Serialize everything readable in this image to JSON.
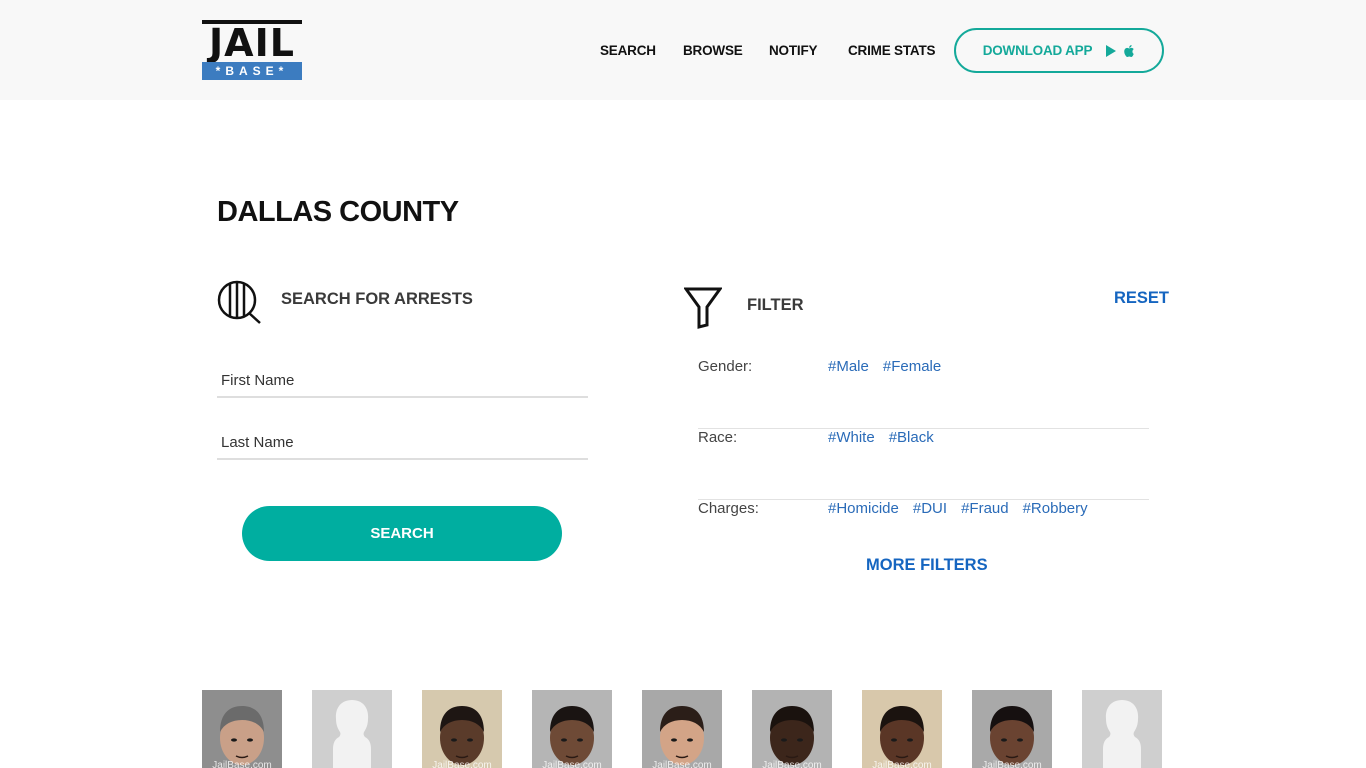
{
  "header": {
    "logo": {
      "top": "JAIL",
      "bottom": "*BASE*"
    },
    "nav": [
      {
        "label": "SEARCH"
      },
      {
        "label": "BROWSE"
      },
      {
        "label": "NOTIFY"
      },
      {
        "label": "CRIME STATS"
      }
    ],
    "download_app_label": "DOWNLOAD APP",
    "download_icons": [
      "google-play-icon",
      "apple-icon"
    ]
  },
  "page_title": "DALLAS COUNTY",
  "search": {
    "heading": "SEARCH FOR ARRESTS",
    "icon": "jail-search-icon",
    "first_name_placeholder": "First Name",
    "first_name_value": "",
    "last_name_placeholder": "Last Name",
    "last_name_value": "",
    "button_label": "SEARCH"
  },
  "filter": {
    "heading": "FILTER",
    "icon": "funnel-icon",
    "reset_label": "RESET",
    "rows": [
      {
        "label": "Gender:",
        "tags": [
          "#Male",
          "#Female"
        ]
      },
      {
        "label": "Race:",
        "tags": [
          "#White",
          "#Black"
        ]
      },
      {
        "label": "Charges:",
        "tags": [
          "#Homicide",
          "#DUI",
          "#Fraud",
          "#Robbery"
        ]
      }
    ],
    "more_label": "MORE FILTERS"
  },
  "mugshots": [
    {
      "type": "photo",
      "bg": "#8e8e8e",
      "skin": "#c9a088",
      "hair": "#6b6b6b",
      "watermark": "JailBase.com"
    },
    {
      "type": "placeholder",
      "bg": "#cfcfcf",
      "watermark": ""
    },
    {
      "type": "photo",
      "bg": "#d6c9ae",
      "skin": "#5a3b2a",
      "hair": "#1e1613",
      "watermark": "JailBase.com"
    },
    {
      "type": "photo",
      "bg": "#b5b5b5",
      "skin": "#6e4a36",
      "hair": "#1a1412",
      "watermark": "JailBase.com"
    },
    {
      "type": "photo",
      "bg": "#a8a8a8",
      "skin": "#d3a487",
      "hair": "#2b1e18",
      "watermark": "JailBase.com"
    },
    {
      "type": "photo",
      "bg": "#b3b3b3",
      "skin": "#3c261b",
      "hair": "#1a120e",
      "watermark": "JailBase.com"
    },
    {
      "type": "photo",
      "bg": "#d8c8ab",
      "skin": "#5a3626",
      "hair": "#1b130f",
      "watermark": "JailBase.com"
    },
    {
      "type": "photo",
      "bg": "#a9a9a9",
      "skin": "#6a4331",
      "hair": "#161010",
      "watermark": "JailBase.com"
    },
    {
      "type": "placeholder",
      "bg": "#cfcfcf",
      "watermark": ""
    }
  ],
  "colors": {
    "accent_teal": "#00aea0",
    "link_blue": "#1565c0",
    "logo_blue": "#3c7cc0"
  }
}
